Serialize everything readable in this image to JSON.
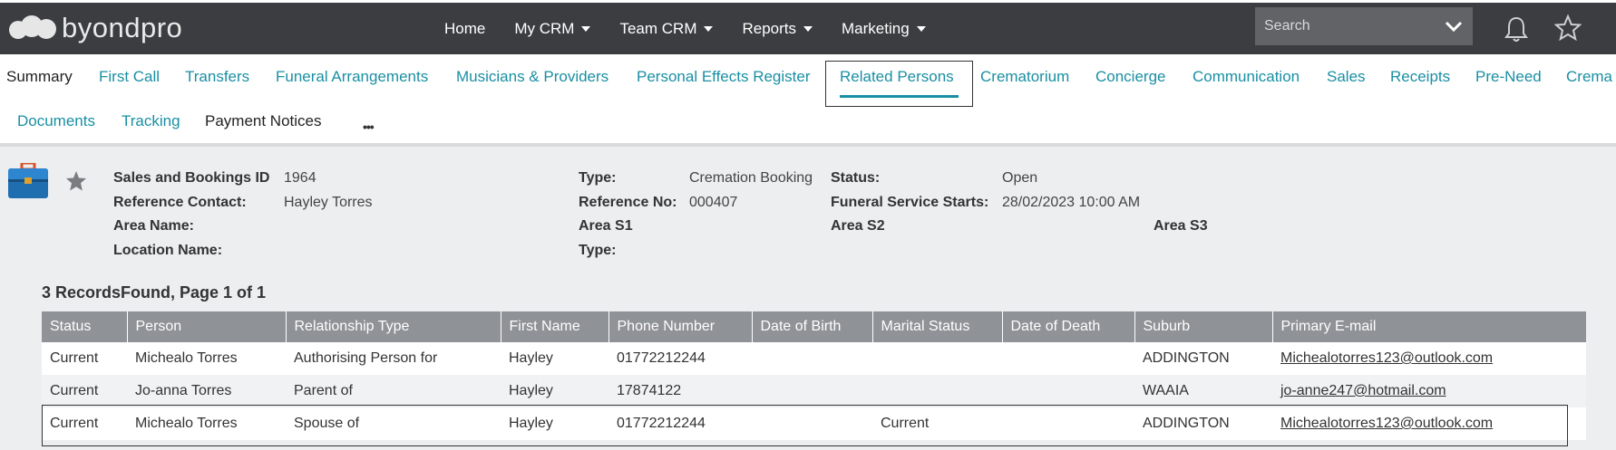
{
  "app": {
    "logo_text": "byondpro"
  },
  "nav": {
    "items": [
      {
        "label": "Home",
        "dropdown": false
      },
      {
        "label": "My CRM",
        "dropdown": true
      },
      {
        "label": "Team CRM",
        "dropdown": true
      },
      {
        "label": "Reports",
        "dropdown": true
      },
      {
        "label": "Marketing",
        "dropdown": true
      }
    ],
    "search_placeholder": "Search"
  },
  "tabs": {
    "row1": [
      "Summary",
      "First Call",
      "Transfers",
      "Funeral Arrangements",
      "Musicians & Providers",
      "Personal Effects Register",
      "Related Persons",
      "Crematorium",
      "Concierge",
      "Communication",
      "Sales",
      "Receipts",
      "Pre-Need",
      "Crema"
    ],
    "row2": [
      "Documents",
      "Tracking",
      "Payment Notices"
    ],
    "active": "Related Persons",
    "more": "•••"
  },
  "info": {
    "sales_id_label": "Sales and Bookings ID",
    "sales_id_value": "1964",
    "ref_contact_label": "Reference Contact:",
    "ref_contact_value": "Hayley Torres",
    "area_name_label": "Area Name:",
    "location_name_label": "Location Name:",
    "type_label": "Type:",
    "type_value": "Cremation Booking",
    "ref_no_label": "Reference No:",
    "ref_no_value": "000407",
    "area_s1_label": "Area S1",
    "type2_label": "Type:",
    "status_label": "Status:",
    "status_value": "Open",
    "funeral_starts_label": "Funeral Service Starts:",
    "funeral_starts_value": "28/02/2023 10:00 AM",
    "area_s2_label": "Area S2",
    "area_s3_label": "Area S3"
  },
  "records_text": "3 RecordsFound, Page 1 of 1",
  "table": {
    "columns": [
      "Status",
      "Person",
      "Relationship Type",
      "First Name",
      "Phone Number",
      "Date of Birth",
      "Marital Status",
      "Date of Death",
      "Suburb",
      "Primary E-mail"
    ],
    "rows": [
      {
        "status": "Current",
        "person": "Michealo Torres",
        "relationship": "Authorising Person for",
        "first_name": "Hayley",
        "phone": "01772212244",
        "dob": "",
        "marital": "",
        "dod": "",
        "suburb": "ADDINGTON",
        "email": "Michealotorres123@outlook.com"
      },
      {
        "status": "Current",
        "person": "Jo-anna Torres",
        "relationship": "Parent of",
        "first_name": "Hayley",
        "phone": "17874122",
        "dob": "",
        "marital": "",
        "dod": "",
        "suburb": "WAAIA",
        "email": "jo-anne247@hotmail.com"
      },
      {
        "status": "Current",
        "person": "Michealo Torres",
        "relationship": "Spouse of",
        "first_name": "Hayley",
        "phone": "01772212244",
        "dob": "",
        "marital": "Current",
        "dod": "",
        "suburb": "ADDINGTON",
        "email": "Michealotorres123@outlook.com"
      }
    ]
  },
  "colors": {
    "accent": "#1a8fa3",
    "topbar": "#3b3d40",
    "header_bg": "#8f9296"
  }
}
